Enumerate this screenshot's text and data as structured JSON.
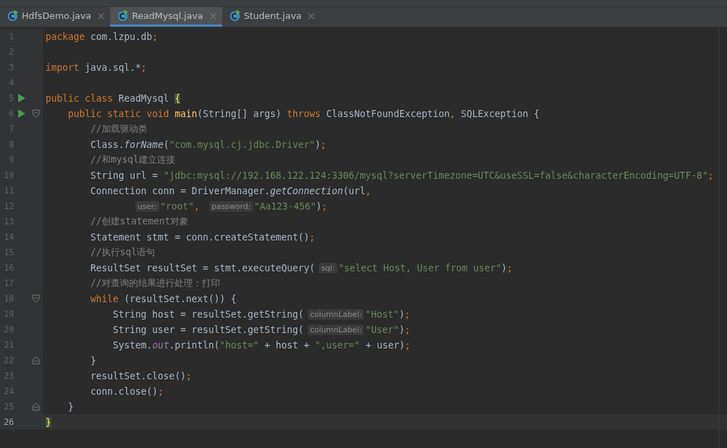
{
  "tabs": [
    {
      "label": "HdfsDemo.java",
      "selected": false
    },
    {
      "label": "ReadMysql.java",
      "selected": true
    },
    {
      "label": "Student.java",
      "selected": false
    }
  ],
  "editor": {
    "lines": [
      {
        "number": "1",
        "segments": [
          {
            "kind": "code",
            "tokens": [
              {
                "kind": "keyword",
                "text": "package "
              },
              {
                "kind": "plain",
                "text": "com.lzpu.db"
              },
              {
                "kind": "punct",
                "text": ";"
              }
            ]
          }
        ]
      },
      {
        "number": "2"
      },
      {
        "number": "3",
        "segments": [
          {
            "kind": "code",
            "tokens": [
              {
                "kind": "keyword",
                "text": "import "
              },
              {
                "kind": "plain",
                "text": "java.sql.*"
              },
              {
                "kind": "punct",
                "text": ";"
              }
            ]
          }
        ]
      },
      {
        "number": "4"
      },
      {
        "number": "5",
        "run": true,
        "segments": [
          {
            "kind": "code",
            "tokens": [
              {
                "kind": "keyword",
                "text": "public class "
              },
              {
                "kind": "plain",
                "text": "ReadMysql "
              },
              {
                "kind": "brace",
                "text": "{"
              }
            ]
          }
        ]
      },
      {
        "number": "6",
        "run": true,
        "fold_start": true,
        "segments": [
          {
            "kind": "code",
            "tokens": [
              {
                "kind": "keyword",
                "text": "    public static void "
              },
              {
                "kind": "function",
                "text": "main"
              },
              {
                "kind": "plain",
                "text": "(String[] args) "
              },
              {
                "kind": "keyword",
                "text": "throws "
              },
              {
                "kind": "plain",
                "text": "ClassNotFoundException"
              },
              {
                "kind": "punct",
                "text": ", "
              },
              {
                "kind": "plain",
                "text": "SQLException {"
              }
            ]
          }
        ]
      },
      {
        "number": "7",
        "segments": [
          {
            "kind": "code",
            "tokens": [
              {
                "kind": "comment",
                "text": "        //加载驱动类"
              }
            ]
          }
        ]
      },
      {
        "number": "8",
        "segments": [
          {
            "kind": "code",
            "tokens": [
              {
                "kind": "plain",
                "text": "        Class."
              },
              {
                "kind": "italic",
                "text": "forName"
              },
              {
                "kind": "plain",
                "text": "("
              },
              {
                "kind": "string",
                "text": "\"com.mysql.cj.jdbc.Driver\""
              },
              {
                "kind": "plain",
                "text": ")"
              },
              {
                "kind": "punct",
                "text": ";"
              }
            ]
          }
        ]
      },
      {
        "number": "9",
        "segments": [
          {
            "kind": "code",
            "tokens": [
              {
                "kind": "comment",
                "text": "        //和mysql建立连接"
              }
            ]
          }
        ]
      },
      {
        "number": "10",
        "segments": [
          {
            "kind": "code",
            "tokens": [
              {
                "kind": "plain",
                "text": "        String url = "
              },
              {
                "kind": "string",
                "text": "\"jdbc:mysql://192.168.122.124:3306/mysql?serverTimezone=UTC&useSSL=false&characterEncoding=UTF-8\""
              },
              {
                "kind": "punct",
                "text": ";"
              }
            ]
          }
        ]
      },
      {
        "number": "11",
        "segments": [
          {
            "kind": "code",
            "tokens": [
              {
                "kind": "plain",
                "text": "        Connection conn = DriverManager."
              },
              {
                "kind": "italic",
                "text": "getConnection"
              },
              {
                "kind": "plain",
                "text": "(url"
              },
              {
                "kind": "punct",
                "text": ","
              }
            ]
          }
        ]
      },
      {
        "number": "12",
        "kind": "continuation",
        "segments": [
          {
            "kind": "hint",
            "text": "user:"
          },
          {
            "kind": "code",
            "tokens": [
              {
                "kind": "string",
                "text": "\"root\""
              },
              {
                "kind": "punct",
                "text": ", "
              }
            ]
          },
          {
            "kind": "hint",
            "text": "password:"
          },
          {
            "kind": "code",
            "tokens": [
              {
                "kind": "string",
                "text": "\"Aa123-456\""
              },
              {
                "kind": "plain",
                "text": ")"
              },
              {
                "kind": "punct",
                "text": ";"
              }
            ]
          }
        ]
      },
      {
        "number": "13",
        "segments": [
          {
            "kind": "code",
            "tokens": [
              {
                "kind": "comment",
                "text": "        //创建statement对象"
              }
            ]
          }
        ]
      },
      {
        "number": "14",
        "segments": [
          {
            "kind": "code",
            "tokens": [
              {
                "kind": "plain",
                "text": "        Statement stmt = conn.createStatement()"
              },
              {
                "kind": "punct",
                "text": ";"
              }
            ]
          }
        ]
      },
      {
        "number": "15",
        "segments": [
          {
            "kind": "code",
            "tokens": [
              {
                "kind": "comment",
                "text": "        //执行sql语句"
              }
            ]
          }
        ]
      },
      {
        "number": "16",
        "segments": [
          {
            "kind": "code",
            "tokens": [
              {
                "kind": "plain",
                "text": "        ResultSet resultSet = stmt.executeQuery("
              }
            ]
          },
          {
            "kind": "hint",
            "text": "sql:"
          },
          {
            "kind": "code",
            "tokens": [
              {
                "kind": "string",
                "text": "\"select Host, User from user\""
              },
              {
                "kind": "plain",
                "text": ")"
              },
              {
                "kind": "punct",
                "text": ";"
              }
            ]
          }
        ]
      },
      {
        "number": "17",
        "segments": [
          {
            "kind": "code",
            "tokens": [
              {
                "kind": "comment",
                "text": "        //对查询的结果进行处理：打印"
              }
            ]
          }
        ]
      },
      {
        "number": "18",
        "fold_start": true,
        "segments": [
          {
            "kind": "code",
            "tokens": [
              {
                "kind": "keyword",
                "text": "        while "
              },
              {
                "kind": "plain",
                "text": "(resultSet.next()) {"
              }
            ]
          }
        ]
      },
      {
        "number": "19",
        "segments": [
          {
            "kind": "code",
            "tokens": [
              {
                "kind": "plain",
                "text": "            String host = resultSet.getString("
              }
            ]
          },
          {
            "kind": "hint",
            "text": "columnLabel:"
          },
          {
            "kind": "code",
            "tokens": [
              {
                "kind": "string",
                "text": "\"Host\""
              },
              {
                "kind": "plain",
                "text": ")"
              },
              {
                "kind": "punct",
                "text": ";"
              }
            ]
          }
        ]
      },
      {
        "number": "20",
        "segments": [
          {
            "kind": "code",
            "tokens": [
              {
                "kind": "plain",
                "text": "            String user = resultSet.getString("
              }
            ]
          },
          {
            "kind": "hint",
            "text": "columnLabel:"
          },
          {
            "kind": "code",
            "tokens": [
              {
                "kind": "string",
                "text": "\"User\""
              },
              {
                "kind": "plain",
                "text": ")"
              },
              {
                "kind": "punct",
                "text": ";"
              }
            ]
          }
        ]
      },
      {
        "number": "21",
        "segments": [
          {
            "kind": "code",
            "tokens": [
              {
                "kind": "plain",
                "text": "            System."
              },
              {
                "kind": "field",
                "text": "out"
              },
              {
                "kind": "plain",
                "text": ".println("
              },
              {
                "kind": "string",
                "text": "\"host=\""
              },
              {
                "kind": "plain",
                "text": " + host + "
              },
              {
                "kind": "string",
                "text": "\",user=\""
              },
              {
                "kind": "plain",
                "text": " + user)"
              },
              {
                "kind": "punct",
                "text": ";"
              }
            ]
          }
        ]
      },
      {
        "number": "22",
        "fold_end": true,
        "segments": [
          {
            "kind": "code",
            "tokens": [
              {
                "kind": "plain",
                "text": "        }"
              }
            ]
          }
        ]
      },
      {
        "number": "23",
        "segments": [
          {
            "kind": "code",
            "tokens": [
              {
                "kind": "plain",
                "text": "        resultSet.close()"
              },
              {
                "kind": "punct",
                "text": ";"
              }
            ]
          }
        ]
      },
      {
        "number": "24",
        "segments": [
          {
            "kind": "code",
            "tokens": [
              {
                "kind": "plain",
                "text": "        conn.close()"
              },
              {
                "kind": "punct",
                "text": ";"
              }
            ]
          }
        ]
      },
      {
        "number": "25",
        "fold_end": true,
        "segments": [
          {
            "kind": "code",
            "tokens": [
              {
                "kind": "plain",
                "text": "    }"
              }
            ]
          }
        ]
      },
      {
        "number": "26",
        "current": true,
        "segments": [
          {
            "kind": "code",
            "tokens": [
              {
                "kind": "brace",
                "text": "}"
              }
            ]
          }
        ]
      }
    ]
  }
}
